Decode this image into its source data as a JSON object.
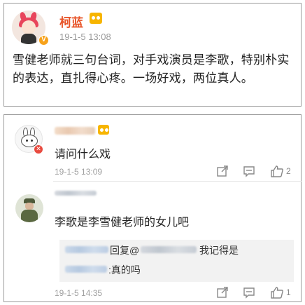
{
  "post": {
    "author": "柯蓝",
    "time": "19-1-5 13:08",
    "text": "雪健老师就三句台词，对手戏演员是李歌，特别朴实的表达，直扎得心疼。一场好戏，两位真人。",
    "author_color": "#e8552a"
  },
  "comments": [
    {
      "text": "请问什么戏",
      "time": "19-1-5 13:09",
      "like_count": "2",
      "avatar": "rabbit-avatar"
    },
    {
      "text": "李歌是李雪健老师的女儿吧",
      "time": "19-1-5 14:35",
      "like_count": "1",
      "avatar": "soldier-avatar",
      "replies": [
        {
          "reply_word": "回复@",
          "text": "我记得是"
        },
        {
          "text": ":真的吗"
        }
      ]
    }
  ],
  "icons": {
    "share": "share-icon",
    "comment": "comment-icon",
    "like": "thumbs-up-icon"
  }
}
